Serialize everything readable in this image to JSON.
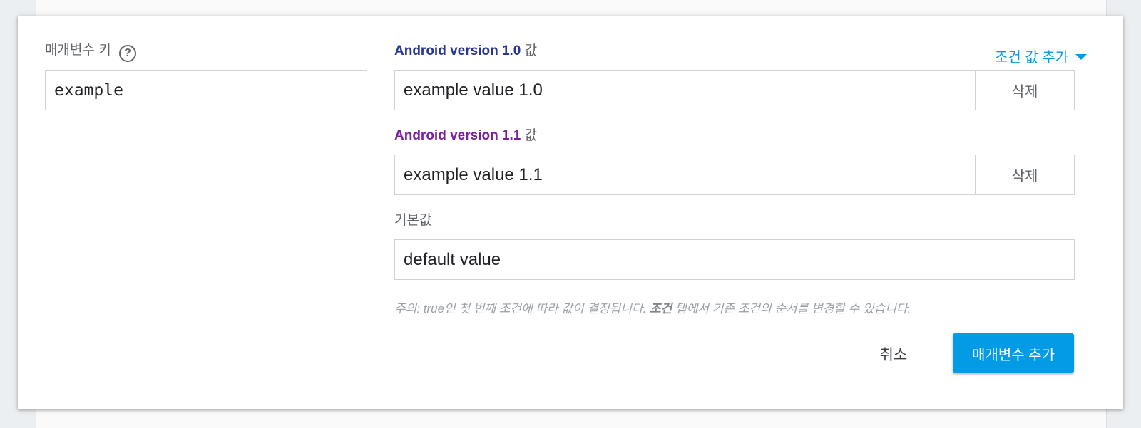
{
  "param_key": {
    "label": "매개변수 키",
    "help_icon": "?",
    "value": "example"
  },
  "add_condition": {
    "label": "조건 값 추가",
    "icon": "caret-down-icon"
  },
  "conditions": [
    {
      "name": "Android version 1.0",
      "suffix": "값",
      "color": "#283593",
      "value": "example value 1.0",
      "delete_label": "삭제"
    },
    {
      "name": "Android version 1.1",
      "suffix": "값",
      "color": "#7b1fa2",
      "value": "example value 1.1",
      "delete_label": "삭제"
    }
  ],
  "default": {
    "label": "기본값",
    "value": "default value"
  },
  "note": {
    "prefix": "주의: true인 첫 번째 조건에 따라 값이 결정됩니다. ",
    "bold": "조건",
    "suffix": " 탭에서 기존 조건의 순서를 변경할 수 있습니다."
  },
  "actions": {
    "cancel": "취소",
    "submit": "매개변수 추가",
    "accent": "#039be5"
  }
}
